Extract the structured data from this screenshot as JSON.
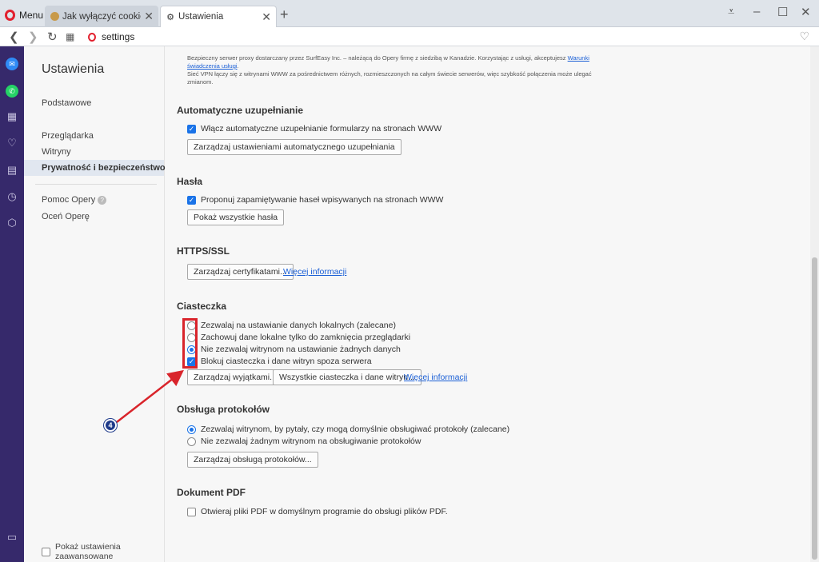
{
  "tabbar": {
    "menu_label": "Menu",
    "tabs": [
      {
        "label": "Jak wyłączyć cookies – ws",
        "icon": "cookie-icon"
      },
      {
        "label": "Ustawienia",
        "icon": "gear-icon"
      }
    ],
    "new_tab_symbol": "+",
    "close_symbol": "✕"
  },
  "address": {
    "url": "settings"
  },
  "nav": {
    "title": "Ustawienia",
    "items": [
      "Podstawowe",
      "Przeglądarka",
      "Witryny",
      "Prywatność i bezpieczeństwo"
    ],
    "help": "Pomoc Opery",
    "rate": "Oceń Operę",
    "advanced": "Pokaż ustawienia zaawansowane"
  },
  "vpn": {
    "line1": "Bezpieczny serwer proxy dostarczany przez SurfEasy Inc. – należącą do Opery firmę z siedzibą w Kanadzie. Korzystając z usługi, akceptujesz ",
    "terms_link_1": "Warunki",
    "terms_link_2": "świadczenia usługi",
    "line1_end": ".",
    "line2": "Sieć VPN łączy się z witrynami WWW za pośrednictwem różnych, rozmieszczonych na całym świecie serwerów, więc szybkość połączenia może ulegać",
    "line3": "zmianom."
  },
  "autofill": {
    "title": "Automatyczne uzupełnianie",
    "option": "Włącz automatyczne uzupełnianie formularzy na stronach WWW",
    "button": "Zarządzaj ustawieniami automatycznego uzupełniania"
  },
  "passwords": {
    "title": "Hasła",
    "option": "Proponuj zapamiętywanie haseł wpisywanych na stronach WWW",
    "button": "Pokaż wszystkie hasła"
  },
  "https": {
    "title": "HTTPS/SSL",
    "button": "Zarządzaj certyfikatami...",
    "link": "Więcej informacji"
  },
  "cookies": {
    "title": "Ciasteczka",
    "options": [
      "Zezwalaj na ustawianie danych lokalnych (zalecane)",
      "Zachowuj dane lokalne tylko do zamknięcia przeglądarki",
      "Nie zezwalaj witrynom na ustawianie żadnych danych",
      "Blokuj ciasteczka i dane witryn spoza serwera"
    ],
    "btn_exceptions": "Zarządzaj wyjątkami...",
    "btn_all": "Wszystkie ciasteczka i dane witryn...",
    "link": "Więcej informacji"
  },
  "protocols": {
    "title": "Obsługa protokołów",
    "options": [
      "Zezwalaj witrynom, by pytały, czy mogą domyślnie obsługiwać protokoły (zalecane)",
      "Nie zezwalaj żadnym witrynom na obsługiwanie protokołów"
    ],
    "button": "Zarządzaj obsługą protokołów..."
  },
  "pdf": {
    "title": "Dokument PDF",
    "option": "Otwieraj pliki PDF w domyślnym programie do obsługi plików PDF."
  },
  "annotation": {
    "step": "4",
    "color": "#d9242b"
  }
}
